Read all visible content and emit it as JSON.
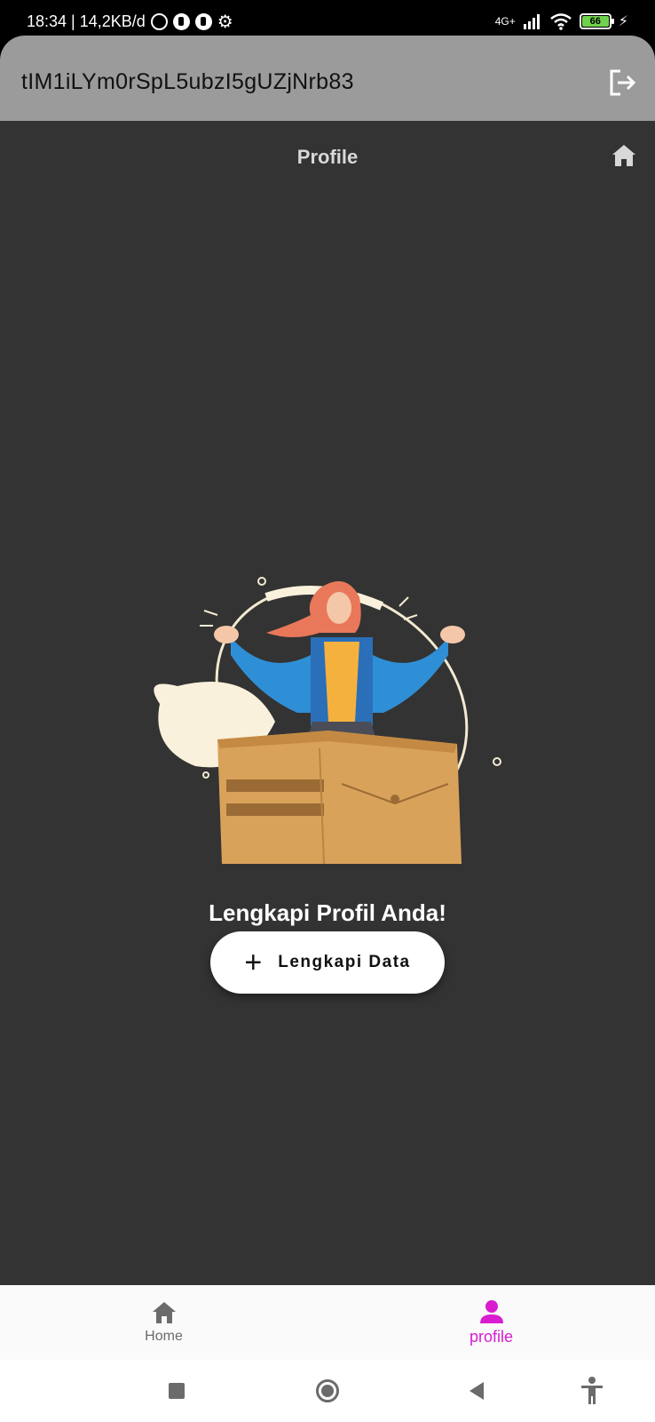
{
  "status_bar": {
    "time_speed": "18:34 | 14,2KB/d",
    "network": "4G+",
    "battery": "66"
  },
  "app_bar": {
    "title": "tIM1iLYm0rSpL5ubzI5gUZjNrb83"
  },
  "page": {
    "title": "Profile"
  },
  "cta": {
    "heading": "Lengkapi Profil Anda!",
    "button_label": "Lengkapi Data"
  },
  "bottom_nav": {
    "items": [
      {
        "label": "Home",
        "icon": "home-icon",
        "active": false
      },
      {
        "label": "profile",
        "icon": "person-icon",
        "active": true
      }
    ]
  },
  "colors": {
    "background": "#333333",
    "app_bar": "#9b9b9b",
    "accent": "#d81ccf",
    "button_bg": "#ffffff"
  }
}
